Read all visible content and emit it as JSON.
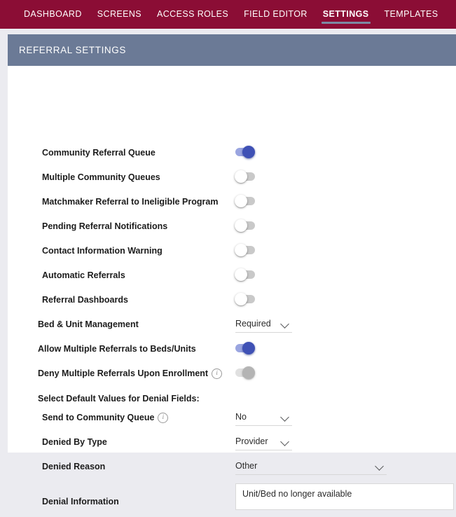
{
  "nav": {
    "tabs": [
      {
        "label": "DASHBOARD",
        "active": false
      },
      {
        "label": "SCREENS",
        "active": false
      },
      {
        "label": "ACCESS ROLES",
        "active": false
      },
      {
        "label": "FIELD EDITOR",
        "active": false
      },
      {
        "label": "SETTINGS",
        "active": true
      },
      {
        "label": "TEMPLATES",
        "active": false
      }
    ],
    "bar_color": "#8b0d35",
    "active_underline_color": "#7c8aa3"
  },
  "card": {
    "header_title": "REFERRAL SETTINGS",
    "header_color": "#6b7a96"
  },
  "settings": {
    "toggle_rows": [
      {
        "label": "Community Referral Queue",
        "state": "on",
        "has_info": false
      },
      {
        "label": "Multiple Community Queues",
        "state": "off",
        "has_info": false
      },
      {
        "label": "Matchmaker Referral to Ineligible Program",
        "state": "off",
        "has_info": false
      },
      {
        "label": "Pending Referral Notifications",
        "state": "off",
        "has_info": false
      },
      {
        "label": "Contact Information Warning",
        "state": "off",
        "has_info": false
      },
      {
        "label": "Automatic Referrals",
        "state": "off",
        "has_info": false
      },
      {
        "label": "Referral Dashboards",
        "state": "off",
        "has_info": false
      }
    ],
    "bed_unit_management": {
      "label": "Bed & Unit Management",
      "value": "Required"
    },
    "allow_multiple_referrals": {
      "label": "Allow Multiple Referrals to Beds/Units",
      "state": "on"
    },
    "deny_multiple_referrals": {
      "label": "Deny Multiple Referrals Upon Enrollment",
      "state": "on-disabled",
      "has_info": true
    },
    "denial_section": {
      "title": "Select Default Values for Denial Fields:",
      "send_to_community_queue": {
        "label": "Send to Community Queue",
        "value": "No",
        "has_info": true
      },
      "denied_by_type": {
        "label": "Denied By Type",
        "value": "Provider",
        "has_info": false
      },
      "denied_reason": {
        "label": "Denied Reason",
        "value": "Other",
        "has_info": false
      },
      "denial_information": {
        "label": "Denial Information",
        "value": "Unit/Bed no longer available"
      }
    }
  },
  "icons": {
    "info": "info-circle-icon",
    "chevron": "chevron-down-icon"
  }
}
